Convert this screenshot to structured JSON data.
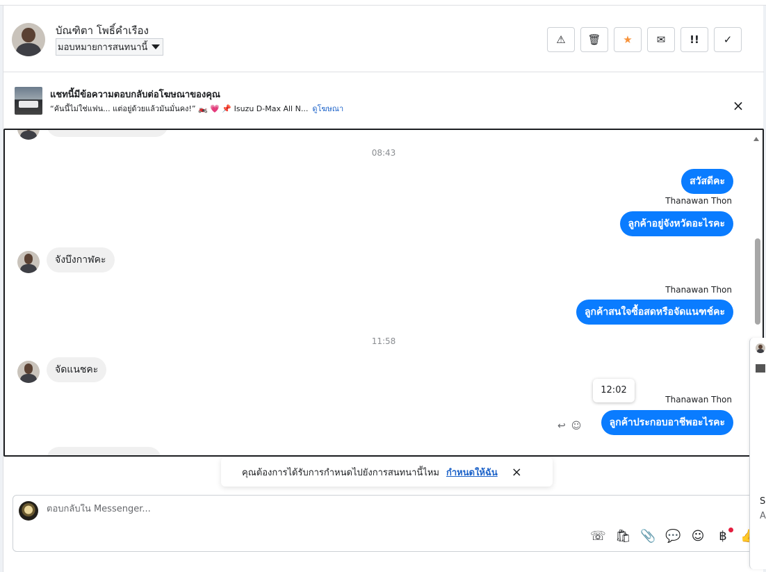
{
  "header": {
    "customer_name": "บัณฑิตา โพธิ์คำเรือง",
    "assign_label": "มอบหมายการสนทนานี้",
    "actions": [
      {
        "name": "spam-warning-button",
        "icon": "⚠"
      },
      {
        "name": "delete-button",
        "icon": "🗑"
      },
      {
        "name": "star-button",
        "icon": "★"
      },
      {
        "name": "mark-unread-button",
        "icon": "✉"
      },
      {
        "name": "follow-up-button",
        "icon": "!!"
      },
      {
        "name": "done-button",
        "icon": "✓"
      }
    ]
  },
  "ad_banner": {
    "title": "แชทนี้มีข้อความตอบกลับต่อโฆษณาของคุณ",
    "subtitle": "“คันนี้ไม่ใช่แฟน... แต่อยู่ด้วยแล้วมันมั่นคง!” 🏍️ 💗 📌 Isuzu D-Max All N...",
    "link": "ดูโฆษณา",
    "close": "×"
  },
  "conversation": {
    "time_separators": [
      "08:43",
      "11:58"
    ],
    "messages": [
      {
        "dir": "out",
        "text": "สวัสดีคะ"
      },
      {
        "dir": "out",
        "sender": "Thanawan Thon",
        "text": "ลูกค้าอยู่จังหวัดอะไรคะ"
      },
      {
        "dir": "in",
        "text": "จังบึงกาฬคะ"
      },
      {
        "dir": "out",
        "sender": "Thanawan Thon",
        "text": "ลูกค้าสนใจซื้อสดหรือจัดแนฑช์คะ"
      },
      {
        "dir": "in",
        "text": "จัดแนชคะ"
      },
      {
        "dir": "out",
        "sender": "Thanawan Thon",
        "text": "ลูกค้าประกอบอาชีพอะไรคะ"
      }
    ],
    "tooltip_time": "12:02",
    "reply_icon": "↩",
    "react_icon": "☺"
  },
  "assign_toast": {
    "text": "คุณต้องการได้รับการกำหนดไปยังการสนทนานี้ไหม",
    "link": "กำหนดให้ฉัน",
    "close": "×"
  },
  "composer": {
    "placeholder": "ตอบกลับใน Messenger...",
    "tools": [
      {
        "name": "call-add-icon",
        "glyph": "☏"
      },
      {
        "name": "shopping-bag-icon",
        "glyph": "🛍"
      },
      {
        "name": "attach-icon",
        "glyph": "📎"
      },
      {
        "name": "saved-replies-icon",
        "glyph": "💬"
      },
      {
        "name": "emoji-icon",
        "glyph": "☺"
      },
      {
        "name": "baht-payment-icon",
        "glyph": "฿"
      },
      {
        "name": "thumbs-up-icon",
        "glyph": "👍"
      }
    ]
  },
  "side_peek": {
    "line1": "S",
    "line2": "A"
  }
}
